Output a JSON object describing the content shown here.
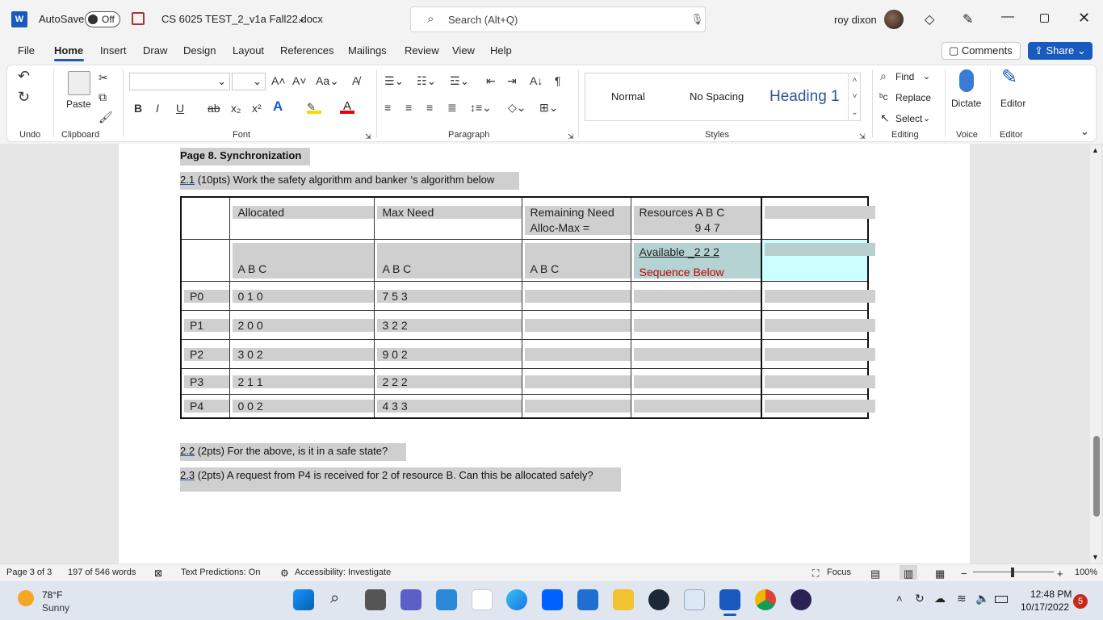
{
  "titlebar": {
    "app_logo": "W",
    "autosave_label": "AutoSave",
    "autosave_state": "Off",
    "filename": "CS 6025 TEST_2_v1a Fall22.docx",
    "search_placeholder": "Search (Alt+Q)",
    "user_name": "roy dixon"
  },
  "menu": {
    "tabs": [
      "File",
      "Home",
      "Insert",
      "Draw",
      "Design",
      "Layout",
      "References",
      "Mailings",
      "Review",
      "View",
      "Help"
    ],
    "active": "Home",
    "comments_label": "Comments",
    "share_label": "Share"
  },
  "ribbon": {
    "groups": {
      "undo": "Undo",
      "clipboard": "Clipboard",
      "font": "Font",
      "paragraph": "Paragraph",
      "styles": "Styles",
      "editing": "Editing",
      "voice": "Voice",
      "editor": "Editor"
    },
    "paste_label": "Paste",
    "styles": [
      "Normal",
      "No Spacing",
      "Heading 1"
    ],
    "find_label": "Find",
    "replace_label": "Replace",
    "select_label": "Select",
    "dictate_label": "Dictate",
    "editor_label": "Editor",
    "font_buttons": [
      "B",
      "I",
      "U",
      "ab",
      "x₂",
      "x²"
    ]
  },
  "document": {
    "heading": "Page 8.  Synchronization",
    "q21_num": "2.1",
    "q21_text": "  (10pts) Work the safety algorithm and banker ‘s algorithm below",
    "table": {
      "header": {
        "allocated": "Allocated",
        "max_need": "Max Need",
        "remaining_line1": "Remaining Need",
        "remaining_line2": "Alloc-Max =",
        "resources_line1": "Resources A   B   C",
        "resources_line2": "9    4    7"
      },
      "subheader": {
        "abc": "A    B    C",
        "available": "Available   _2 2 2",
        "sequence": "Sequence Below"
      },
      "rows": [
        {
          "proc": "P0",
          "alloc": "0    1    0",
          "max": "7    5    3"
        },
        {
          "proc": "P1",
          "alloc": "2    0    0",
          "max": "3    2    2"
        },
        {
          "proc": "P2",
          "alloc": "3    0    2",
          "max": "9    0    2"
        },
        {
          "proc": "P3",
          "alloc": "2    1    1",
          "max": "2    2    2"
        },
        {
          "proc": "P4",
          "alloc": "0    0    2",
          "max": "4    3    3"
        }
      ]
    },
    "q22_num": "2.2",
    "q22_text": "  (2pts) For the above, is it in a safe state?",
    "q23_num": "2.3",
    "q23_text": "  (2pts) A request from P4 is received for 2 of resource B.  Can this be allocated safely?"
  },
  "statusbar": {
    "page": "Page 3 of 3",
    "words": "197 of 546 words",
    "predictions": "Text Predictions: On",
    "accessibility": "Accessibility: Investigate",
    "focus": "Focus",
    "zoom": "100%"
  },
  "taskbar": {
    "temperature": "78°F",
    "condition": "Sunny",
    "time": "12:48 PM",
    "date": "10/17/2022",
    "notifications": "5"
  },
  "colors": {
    "word_blue": "#185abd",
    "selection_gray": "#cfcfcf",
    "red_text": "#c00000",
    "cyan_cell": "#ccffff"
  }
}
